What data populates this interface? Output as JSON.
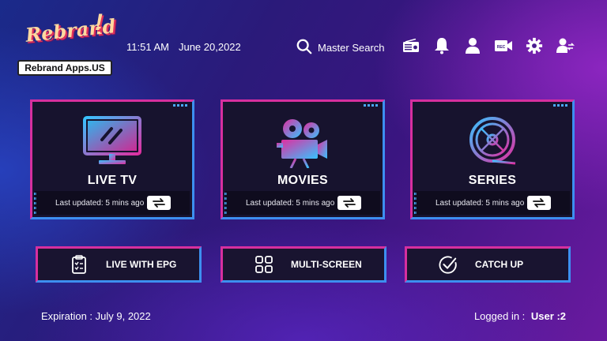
{
  "logo": {
    "word": "Rebrand",
    "subtitle": "Rebrand Apps.US"
  },
  "header": {
    "time": "11:51 AM",
    "date": "June 20,2022",
    "search_label": "Master Search",
    "icons": [
      "radio-icon",
      "bell-icon",
      "user-icon",
      "record-icon",
      "gear-icon",
      "switch-user-icon"
    ]
  },
  "cards": [
    {
      "title": "LIVE TV",
      "updated": "Last updated: 5 mins ago",
      "icon": "tv-icon"
    },
    {
      "title": "MOVIES",
      "updated": "Last updated: 5 mins ago",
      "icon": "movie-camera-icon"
    },
    {
      "title": "SERIES",
      "updated": "Last updated: 5 mins ago",
      "icon": "film-reel-icon"
    }
  ],
  "buttons": [
    {
      "label": "LIVE WITH EPG",
      "icon": "clipboard-checklist-icon"
    },
    {
      "label": "MULTI-SCREEN",
      "icon": "grid-icon"
    },
    {
      "label": "CATCH UP",
      "icon": "check-circle-icon"
    }
  ],
  "footer": {
    "expiration": "Expiration : July 9, 2022",
    "logged_in_label": "Logged in :",
    "user": "User :2"
  },
  "colors": {
    "accent_pink": "#d72f9f",
    "accent_blue": "#3d8ff0",
    "card_bg": "#17132e"
  }
}
